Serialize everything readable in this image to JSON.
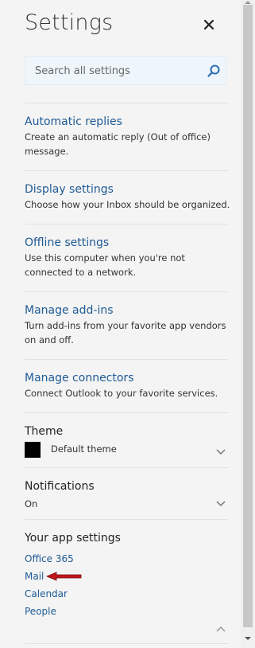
{
  "header": {
    "title": "Settings",
    "close_symbol": "✕"
  },
  "search": {
    "placeholder": "Search all settings"
  },
  "settings": [
    {
      "label": "Automatic replies",
      "description": "Create an automatic reply (Out of office) message."
    },
    {
      "label": "Display settings",
      "description": "Choose how your Inbox should be organized."
    },
    {
      "label": "Offline settings",
      "description": "Use this computer when you're not connected to a network."
    },
    {
      "label": "Manage add-ins",
      "description": "Turn add-ins from your favorite app vendors on and off."
    },
    {
      "label": "Manage connectors",
      "description": "Connect Outlook to your favorite services."
    }
  ],
  "theme": {
    "label": "Theme",
    "value": "Default theme",
    "swatch_color": "#000000"
  },
  "notifications": {
    "label": "Notifications",
    "value": "On"
  },
  "app_settings": {
    "label": "Your app settings",
    "links": [
      "Office 365",
      "Mail",
      "Calendar",
      "People"
    ]
  },
  "colors": {
    "link": "#1e5a94",
    "annotation_arrow": "#c0161b"
  }
}
